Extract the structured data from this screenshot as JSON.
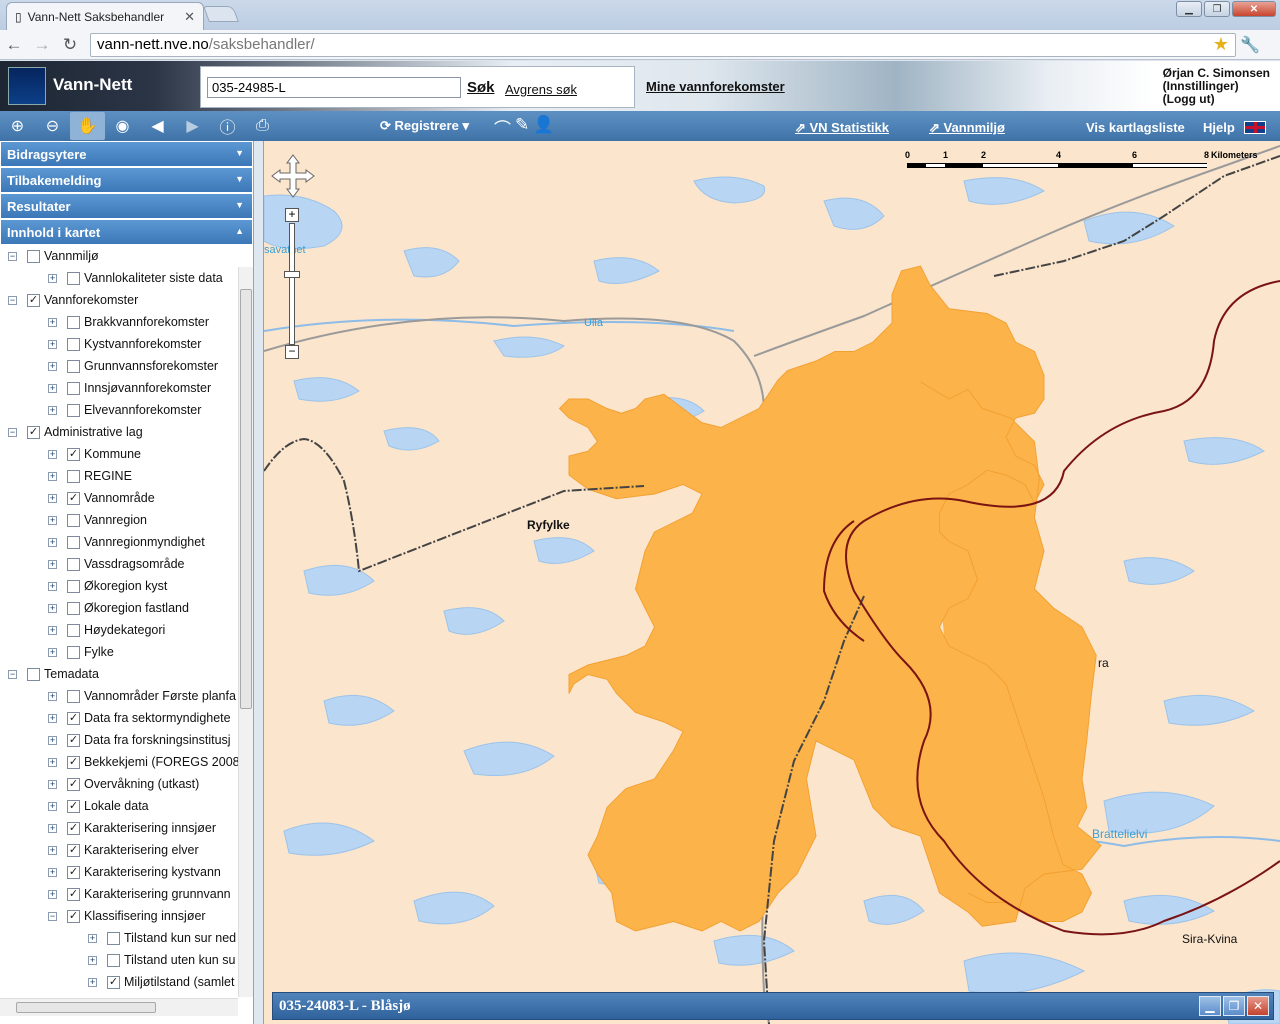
{
  "browser": {
    "tab_title": "Vann-Nett Saksbehandler",
    "url_host": "vann-nett.nve.no",
    "url_path": "/saksbehandler/"
  },
  "header": {
    "app_name": "Vann-Nett",
    "search_value": "035-24985-L",
    "search_button": "Søk",
    "refine_link": "Avgrens søk",
    "my_waters_link": "Mine vannforekomster",
    "user_name": "Ørjan C. Simonsen",
    "user_settings": "(Innstillinger)",
    "user_logout": "(Logg ut)"
  },
  "toolbar": {
    "register": "Registrere",
    "statistics": "VN Statistikk",
    "environment": "Vannmiljø",
    "layer_list": "Vis kartlagsliste",
    "help": "Hjelp",
    "tools": [
      "zoom-in-icon",
      "zoom-out-icon",
      "pan-hand-icon",
      "full-extent-icon",
      "previous-extent-icon",
      "next-extent-icon",
      "info-icon",
      "print-icon"
    ]
  },
  "sidebar": {
    "sections": [
      "Bidragsytere",
      "Tilbakemelding",
      "Resultater",
      "Innhold i kartet"
    ],
    "tree": [
      {
        "level": 0,
        "label": "Vannmiljø",
        "checked": false,
        "exp": "−"
      },
      {
        "level": 1,
        "label": "Vannlokaliteter siste data",
        "checked": false,
        "exp": "+"
      },
      {
        "level": 0,
        "label": "Vannforekomster",
        "checked": true,
        "exp": "−"
      },
      {
        "level": 1,
        "label": "Brakkvannforekomster",
        "checked": false,
        "exp": "+"
      },
      {
        "level": 1,
        "label": "Kystvannforekomster",
        "checked": false,
        "exp": "+"
      },
      {
        "level": 1,
        "label": "Grunnvannsforekomster",
        "checked": false,
        "exp": "+"
      },
      {
        "level": 1,
        "label": "Innsjøvannforekomster",
        "checked": false,
        "exp": "+"
      },
      {
        "level": 1,
        "label": "Elvevannforekomster",
        "checked": false,
        "exp": "+"
      },
      {
        "level": 0,
        "label": "Administrative lag",
        "checked": true,
        "exp": "−"
      },
      {
        "level": 1,
        "label": "Kommune",
        "checked": true,
        "exp": "+"
      },
      {
        "level": 1,
        "label": "REGINE",
        "checked": false,
        "exp": "+"
      },
      {
        "level": 1,
        "label": "Vannområde",
        "checked": true,
        "exp": "+"
      },
      {
        "level": 1,
        "label": "Vannregion",
        "checked": false,
        "exp": "+"
      },
      {
        "level": 1,
        "label": "Vannregionmyndighet",
        "checked": false,
        "exp": "+"
      },
      {
        "level": 1,
        "label": "Vassdragsområde",
        "checked": false,
        "exp": "+"
      },
      {
        "level": 1,
        "label": "Økoregion kyst",
        "checked": false,
        "exp": "+"
      },
      {
        "level": 1,
        "label": "Økoregion fastland",
        "checked": false,
        "exp": "+"
      },
      {
        "level": 1,
        "label": "Høydekategori",
        "checked": false,
        "exp": "+"
      },
      {
        "level": 1,
        "label": "Fylke",
        "checked": false,
        "exp": "+"
      },
      {
        "level": 0,
        "label": "Temadata",
        "checked": false,
        "exp": "−"
      },
      {
        "level": 1,
        "label": "Vannområder Første planfa",
        "checked": false,
        "exp": "+"
      },
      {
        "level": 1,
        "label": "Data fra sektormyndighete",
        "checked": true,
        "exp": "+"
      },
      {
        "level": 1,
        "label": "Data fra forskningsinstitusj",
        "checked": true,
        "exp": "+"
      },
      {
        "level": 1,
        "label": "Bekkekjemi (FOREGS 2008",
        "checked": true,
        "exp": "+"
      },
      {
        "level": 1,
        "label": "Overvåkning (utkast)",
        "checked": true,
        "exp": "+"
      },
      {
        "level": 1,
        "label": "Lokale data",
        "checked": true,
        "exp": "+"
      },
      {
        "level": 1,
        "label": "Karakterisering innsjøer",
        "checked": true,
        "exp": "+"
      },
      {
        "level": 1,
        "label": "Karakterisering elver",
        "checked": true,
        "exp": "+"
      },
      {
        "level": 1,
        "label": "Karakterisering kystvann",
        "checked": true,
        "exp": "+"
      },
      {
        "level": 1,
        "label": "Karakterisering grunnvann",
        "checked": true,
        "exp": "+"
      },
      {
        "level": 1,
        "label": "Klassifisering innsjøer",
        "checked": true,
        "exp": "−"
      },
      {
        "level": 2,
        "label": "Tilstand kun sur ned",
        "checked": false,
        "exp": "+"
      },
      {
        "level": 2,
        "label": "Tilstand uten kun su",
        "checked": false,
        "exp": "+"
      },
      {
        "level": 2,
        "label": "Miljøtilstand (samlet",
        "checked": true,
        "exp": "+"
      }
    ]
  },
  "map": {
    "labels": {
      "ryfylke": "Ryfylke",
      "ulla": "Ulla",
      "sira_kvina": "Sira-Kvina",
      "brattelielvi": "Brattelielvi",
      "sava": "savatnet",
      "ra": "ra"
    },
    "scale": {
      "ticks": [
        "0",
        "1",
        "2",
        "4",
        "6",
        "8"
      ],
      "unit": "Kilometers"
    },
    "colors": {
      "land": "#fbe5cc",
      "highlight": "#fbb34a",
      "water": "#b8d6f3",
      "border": "#7a1414"
    }
  },
  "info_panel": {
    "title": "035-24083-L - Blåsjø"
  }
}
